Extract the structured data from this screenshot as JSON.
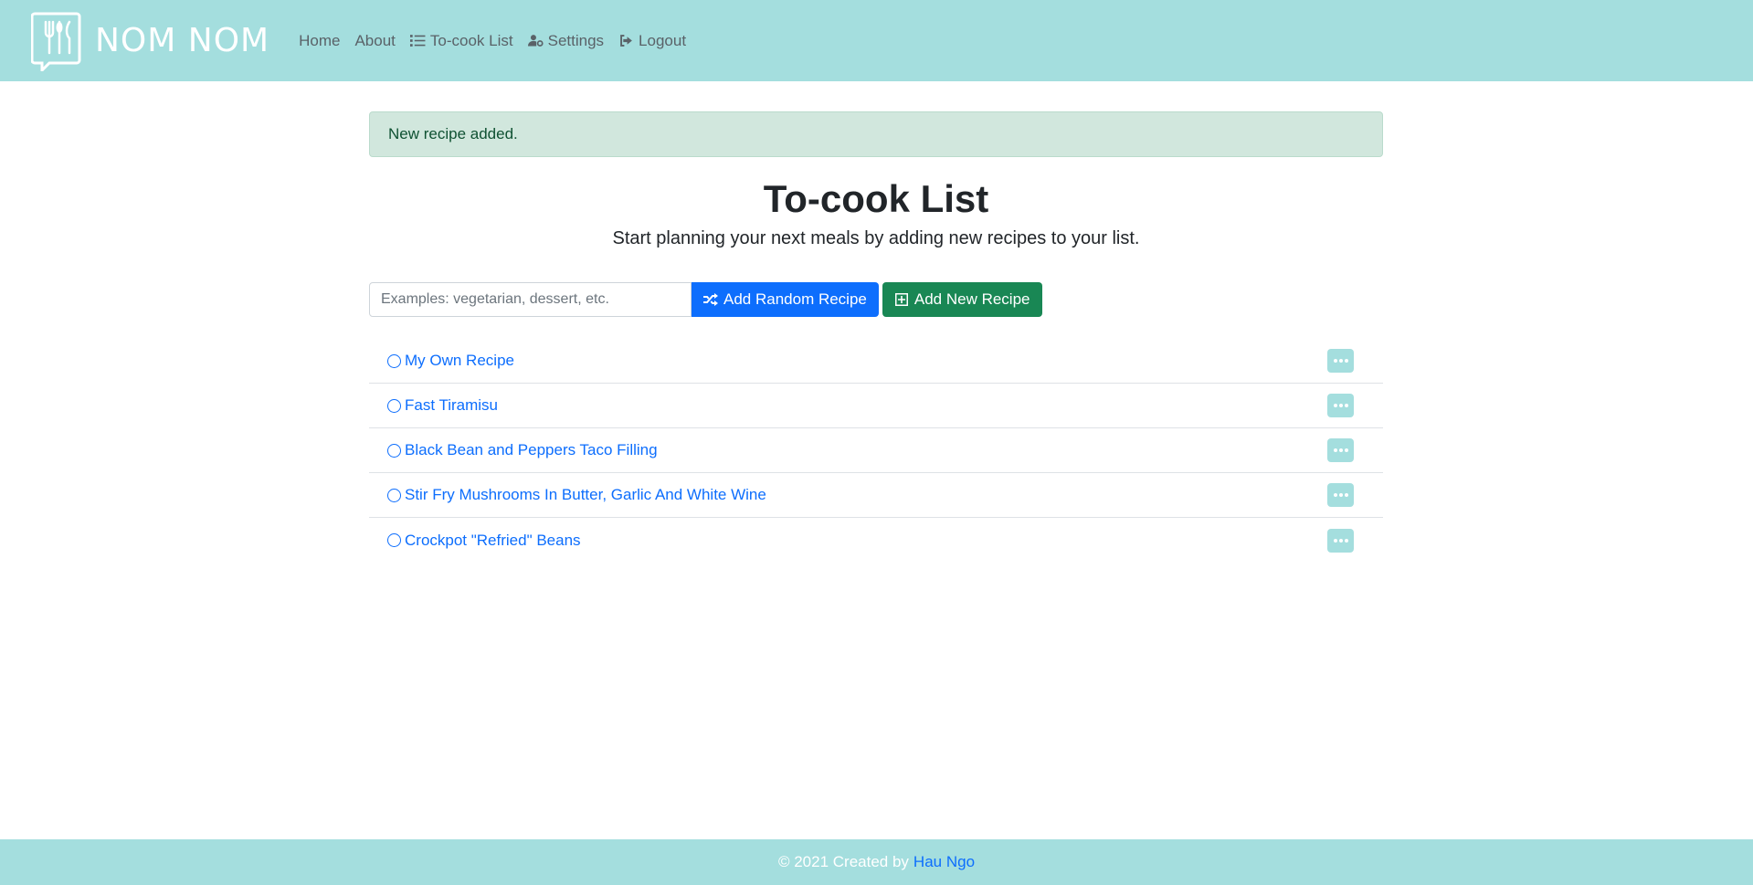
{
  "brand": {
    "name": "NOM NOM"
  },
  "nav": {
    "home": "Home",
    "about": "About",
    "tocook": "To-cook List",
    "settings": "Settings",
    "logout": "Logout"
  },
  "alert": {
    "message": "New recipe added."
  },
  "page": {
    "title": "To-cook List",
    "lead": "Start planning your next meals by adding new recipes to your list."
  },
  "toolbar": {
    "search_placeholder": "Examples: vegetarian, dessert, etc.",
    "random_label": "Add Random Recipe",
    "new_label": "Add New Recipe"
  },
  "recipes": [
    {
      "name": "My Own Recipe"
    },
    {
      "name": "Fast Tiramisu"
    },
    {
      "name": "Black Bean and Peppers Taco Filling"
    },
    {
      "name": "Stir Fry Mushrooms In Butter, Garlic And White Wine"
    },
    {
      "name": "Crockpot \"Refried\" Beans"
    }
  ],
  "footer": {
    "text": "© 2021 Created by",
    "author": "Hau Ngo"
  },
  "colors": {
    "navbar": "#a4dede",
    "primary": "#0d6efd",
    "success": "#198754",
    "alert_bg": "#d1e7dd"
  }
}
